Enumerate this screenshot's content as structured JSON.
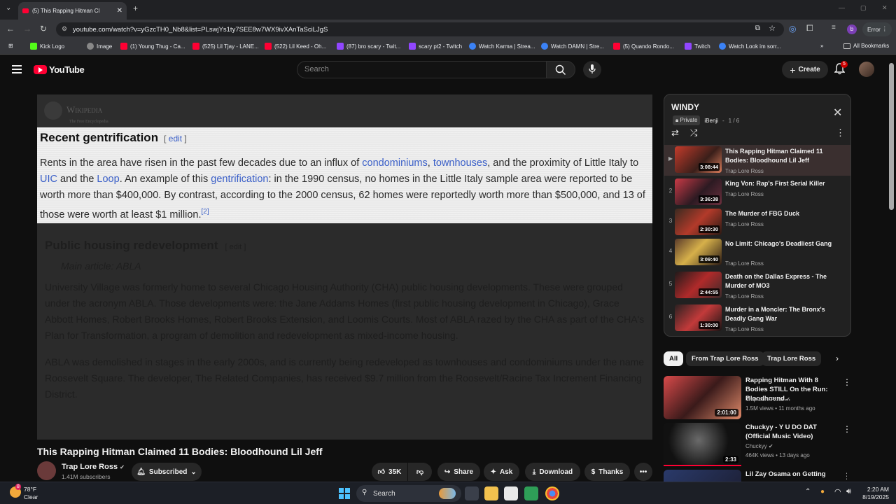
{
  "browser": {
    "tab_title": "(5) This Rapping Hitman Cl",
    "url": "youtube.com/watch?v=yGzcTH0_Nb8&list=PLswjYs1ty7SEE8w7WX9ivXAnTaSciLJgS",
    "error_label": "Error",
    "profile_initial": "b",
    "bookmarks": [
      "Kick Logo",
      "Image",
      "(1) Young Thug - Ca...",
      "(525) Lil Tjay - LANE...",
      "(522) Lil Keed - Oh...",
      "(87) bro scary - Twit...",
      "scary pt2 - Twitch",
      "Watch Karma | Strea...",
      "Watch DAMN | Stre...",
      "(5) Quando Rondo...",
      "Twitch",
      "Watch Look im sorr..."
    ],
    "all_bookmarks": "All Bookmarks"
  },
  "youtube": {
    "logo": "YouTube",
    "search_placeholder": "Search",
    "create_label": "Create",
    "notif_count": "5"
  },
  "video": {
    "wiki_logo": "Wikipedia",
    "wiki_tagline": "The Free Encyclopedia",
    "section1": {
      "heading": "Recent gentrification",
      "edit_open": "[",
      "edit": "edit",
      "edit_close": "]",
      "p_a": "Rents in the area have risen in the past few decades due to an influx of ",
      "l_condo": "condominiums",
      "p_comma": ", ",
      "l_town": "townhouses",
      "p_b": ", and the proximity of Little Italy to ",
      "l_uic": "UIC",
      "p_c": " and the ",
      "l_loop": "Loop",
      "p_d": ". An example of this ",
      "l_gent": "gentrification",
      "p_e": ": in the 1990 census, no homes in the Little Italy sample area were reported to be worth more than $400,000. By contrast, according to the 2000 census, 62 homes were reportedly worth more than $500,000, and 13 of those were worth at least $1 million.",
      "ref": "[2]"
    },
    "section2": {
      "heading": "Public housing redevelopment",
      "edit": "[ edit ]",
      "main_article": "Main article: ABLA",
      "p1": "University Village was formerly home to several Chicago Housing Authority (CHA) public housing developments. These were grouped under the acronym ABLA. Those developments were: the Jane Addams Homes (first public housing development in Chicago), Grace Abbott Homes, Robert Brooks Homes, Robert Brooks Extension, and Loomis Courts. Most of ABLA razed by the CHA as part of the CHA's Plan for Transformation, a program of demolition and redevelopment as mixed-income housing.",
      "p2": "ABLA was demolished in stages in the early 2000s, and is currently being redeveloped as townhouses and condominiums under the name Roosevelt Square. The developer, The Related Companies, has received $9.7 million from the Roosevelt/Racine Tax Increment Financing District."
    },
    "title": "This Rapping Hitman Claimed 11 Bodies: Bloodhound Lil Jeff",
    "channel": "Trap Lore Ross",
    "subscribers": "1.41M subscribers",
    "subscribed_label": "Subscribed",
    "likes": "35K",
    "share": "Share",
    "ask": "Ask",
    "download": "Download",
    "thanks": "Thanks"
  },
  "playlist": {
    "title": "WINDY",
    "privacy": "Private",
    "owner": "iBenji",
    "position": "1 / 6",
    "items": [
      {
        "num": "▶",
        "title": "This Rapping Hitman Claimed 11 Bodies: Bloodhound Lil Jeff",
        "channel": "Trap Lore Ross",
        "duration": "3:08:44"
      },
      {
        "num": "2",
        "title": "King Von: Rap's First Serial Killer",
        "channel": "Trap Lore Ross",
        "duration": "3:36:38"
      },
      {
        "num": "3",
        "title": "The Murder of FBG Duck",
        "channel": "Trap Lore Ross",
        "duration": "2:30:30"
      },
      {
        "num": "4",
        "title": "No Limit: Chicago's Deadliest Gang",
        "channel": "Trap Lore Ross",
        "duration": "3:09:40"
      },
      {
        "num": "5",
        "title": "Death on the Dallas Express - The Murder of MO3",
        "channel": "Trap Lore Ross",
        "duration": "2:44:55"
      },
      {
        "num": "6",
        "title": "Murder in a Moncler: The Bronx's Deadly Gang War",
        "channel": "Trap Lore Ross",
        "duration": "1:30:00"
      }
    ]
  },
  "chips": [
    "All",
    "From Trap Lore Ross",
    "Trap Lore Ross"
  ],
  "recommended": [
    {
      "title": "Rapping Hitman With 8 Bodies STILL On the Run: Bloodhound...",
      "channel": "Trap Lore Ross",
      "meta": "1.5M views • 11 months ago",
      "duration": "2:01:00"
    },
    {
      "title": "Chuckyy - Y U DO DAT (Official Music Video)",
      "channel": "Chuckyy",
      "meta": "464K views • 13 days ago",
      "duration": "2:33"
    },
    {
      "title": "Lil Zay Osama on Getting",
      "channel": "",
      "meta": "",
      "duration": ""
    }
  ],
  "taskbar": {
    "weather_temp": "78°F",
    "weather_desc": "Clear",
    "weather_badge": "8",
    "search": "Search",
    "time": "2:20 AM",
    "date": "8/19/2025"
  }
}
